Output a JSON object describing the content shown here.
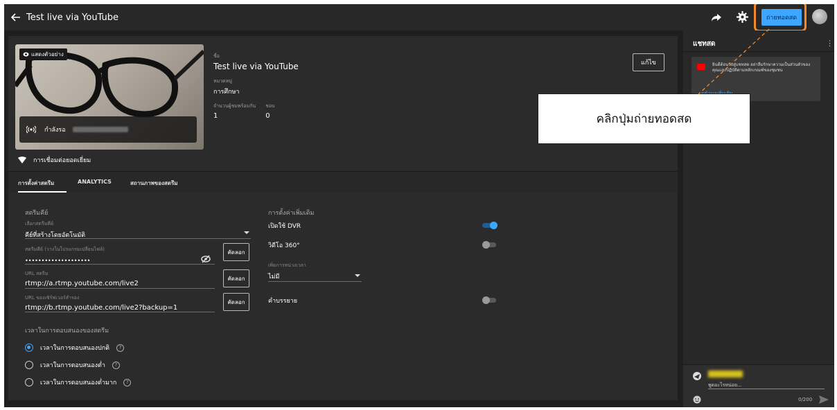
{
  "header": {
    "title": "Test live via YouTube",
    "live_button": "ถ่ายทอดสด"
  },
  "preview": {
    "badge": "แสดงตัวอย่าง",
    "status": "กำลังรอ"
  },
  "stream_info": {
    "title_label": "ชื่อ",
    "title_value": "Test live via YouTube",
    "category_label": "หมวดหมู่",
    "category_value": "การศึกษา",
    "viewers_label": "จำนวนผู้ชมพร้อมกัน",
    "viewers_value": "1",
    "likes_label": "ชอบ",
    "likes_value": "0",
    "edit_button": "แก้ไข"
  },
  "connection": "การเชื่อมต่อยอดเยี่ยม",
  "tabs": [
    "การตั้งค่าสตรีม",
    "ANALYTICS",
    "สถานภาพของสตรีม"
  ],
  "stream_key": {
    "section": "สตรีมคีย์",
    "select_label": "เลือกสตรีมคีย์",
    "select_value": "คีย์ที่สร้างโดยอัตโนมัติ",
    "key_label": "สตรีมคีย์ (วางในโปรแกรมเปลี่ยนไฟล์)",
    "key_value": "••••••••••••••••••••",
    "url_label": "URL สตรีม",
    "url_value": "rtmp://a.rtmp.youtube.com/live2",
    "backup_label": "URL ของเซิร์ฟเวอร์สำรอง",
    "backup_value": "rtmp://b.rtmp.youtube.com/live2?backup=1",
    "copy_button": "คัดลอก"
  },
  "latency": {
    "section": "เวลาในการตอบสนองของสตรีม",
    "options": [
      "เวลาในการตอบสนองปกติ",
      "เวลาในการตอบสนองต่ำ",
      "เวลาในการตอบสนองต่ำมาก"
    ],
    "selected_index": 0
  },
  "additional": {
    "section": "การตั้งค่าเพิ่มเติม",
    "dvr_label": "เปิดใช้ DVR",
    "dvr_on": true,
    "video360_label": "วิดีโอ 360°",
    "video360_on": false,
    "delay_label": "เพิ่มการหน่วงเวลา",
    "delay_value": "ไม่มี",
    "captions_label": "คำบรรยาย",
    "captions_on": false
  },
  "chat": {
    "title": "แชทสด",
    "notice": "ยินดีต้อนรับสู่แชทสด อย่าลืมรักษาความเป็นส่วนตัวของคุณและปฏิบัติตามหลักเกณฑ์ของชุมชน",
    "notice_link": "ดูข้อมูลเพิ่มเติม",
    "input_placeholder": "พูดอะไรหน่อย...",
    "char_count": "0/200"
  },
  "callout": "คลิกปุ่มถ่ายทอดสด",
  "colors": {
    "accent": "#3ea6ff",
    "highlight": "#f38a2c",
    "background": "#1f1f1f"
  }
}
